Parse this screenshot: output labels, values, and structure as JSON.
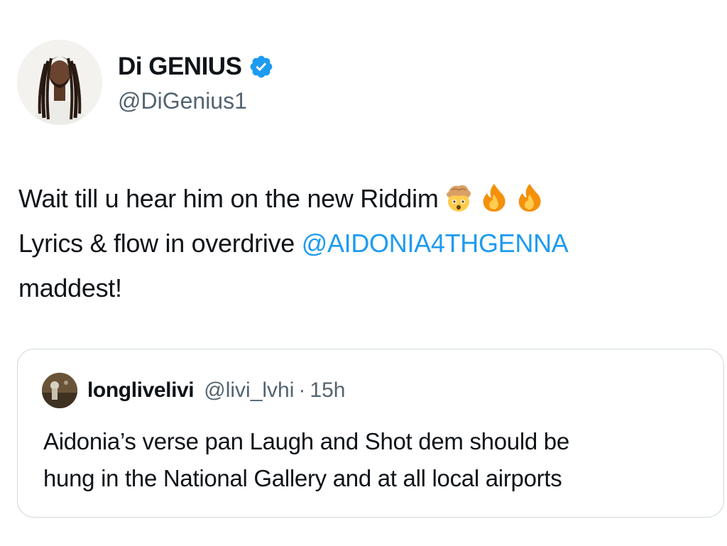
{
  "tweet": {
    "author": {
      "name": "Di GENIUS",
      "handle": "@DiGenius1",
      "verified": true,
      "avatar": "profile-photo"
    },
    "text": {
      "line1": "Wait till u hear him on the new Riddim",
      "line1_emojis": [
        "exploding-head-emoji",
        "fire-emoji",
        "fire-emoji"
      ],
      "line2_prefix": "Lyrics & flow in overdrive ",
      "mention": "@AIDONIA4THGENNA",
      "line3": "maddest!"
    },
    "quote": {
      "author": "longlivelivi",
      "handle": "@livi_lvhi",
      "separator": "·",
      "time": "15h",
      "text_line1": "Aidonia’s verse pan Laugh and Shot dem should be",
      "text_line2": "hung in the National Gallery and at all local airports"
    }
  },
  "colors": {
    "text_primary": "#0f1419",
    "text_secondary": "#536471",
    "link": "#1d9bf0",
    "verified_badge": "#1d9bf0",
    "card_border": "#cfd9de"
  }
}
